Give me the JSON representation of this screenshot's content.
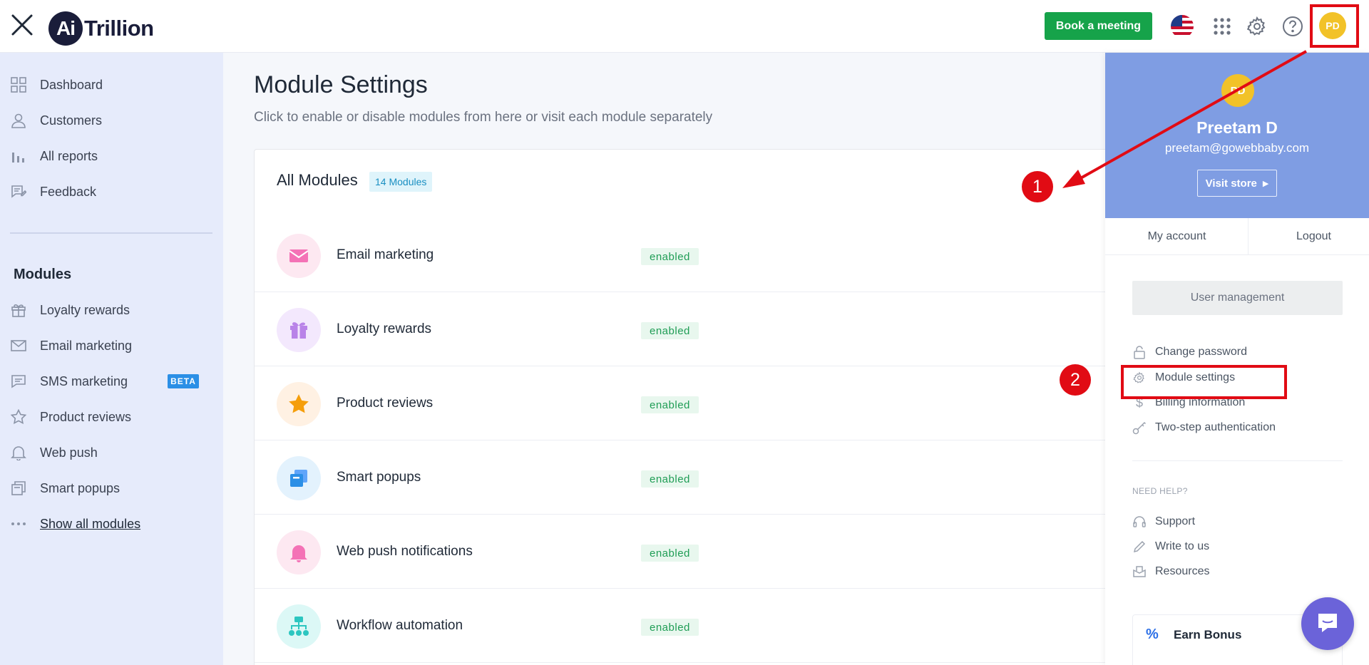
{
  "header": {
    "logo_mark": "Ai",
    "logo_text": "Trillion",
    "book_meeting": "Book a meeting",
    "avatar_initials": "PD",
    "icons": [
      "close-icon",
      "us-flag-icon",
      "apps-grid-icon",
      "gear-icon",
      "help-icon"
    ]
  },
  "sidebar": {
    "top_items": [
      {
        "label": "Dashboard",
        "icon": "dashboard-icon"
      },
      {
        "label": "Customers",
        "icon": "user-icon"
      },
      {
        "label": "All reports",
        "icon": "bar-chart-icon"
      },
      {
        "label": "Feedback",
        "icon": "feedback-icon"
      }
    ],
    "modules_heading": "Modules",
    "module_items": [
      {
        "label": "Loyalty rewards",
        "icon": "gift-icon"
      },
      {
        "label": "Email marketing",
        "icon": "mail-icon"
      },
      {
        "label": "SMS marketing",
        "icon": "chat-icon",
        "badge": "BETA"
      },
      {
        "label": "Product reviews",
        "icon": "star-icon"
      },
      {
        "label": "Web push",
        "icon": "bell-icon"
      },
      {
        "label": "Smart popups",
        "icon": "popup-icon"
      }
    ],
    "show_all": "Show all modules"
  },
  "main": {
    "title": "Module Settings",
    "subtitle": "Click to enable or disable modules from here or visit each module separately",
    "card_title": "All Modules",
    "count_badge": "14 Modules",
    "modules": [
      {
        "name": "Email marketing",
        "status": "enabled",
        "icon": "mail-icon"
      },
      {
        "name": "Loyalty rewards",
        "status": "enabled",
        "icon": "gift-icon"
      },
      {
        "name": "Product reviews",
        "status": "enabled",
        "icon": "star-icon"
      },
      {
        "name": "Smart popups",
        "status": "enabled",
        "icon": "popup-icon"
      },
      {
        "name": "Web push notifications",
        "status": "enabled",
        "icon": "bell-icon"
      },
      {
        "name": "Workflow automation",
        "status": "enabled",
        "icon": "workflow-icon"
      }
    ]
  },
  "panel": {
    "avatar_initials": "PD",
    "name": "Preetam D",
    "email": "preetam@gowebbaby.com",
    "visit_store": "Visit store",
    "my_account": "My account",
    "logout": "Logout",
    "user_management": "User management",
    "links": [
      {
        "label": "Change password",
        "icon": "lock-icon"
      },
      {
        "label": "Module settings",
        "icon": "gear-icon"
      },
      {
        "label": "Billing information",
        "icon": "dollar-icon"
      },
      {
        "label": "Two-step authentication",
        "icon": "key-icon"
      }
    ],
    "help_heading": "NEED HELP?",
    "help_links": [
      {
        "label": "Support",
        "icon": "headset-icon"
      },
      {
        "label": "Write to us",
        "icon": "pencil-icon"
      },
      {
        "label": "Resources",
        "icon": "resources-icon"
      }
    ],
    "earn_bonus": "Earn Bonus"
  },
  "annotations": {
    "step1": "1",
    "step2": "2",
    "color": "#e10b14"
  }
}
